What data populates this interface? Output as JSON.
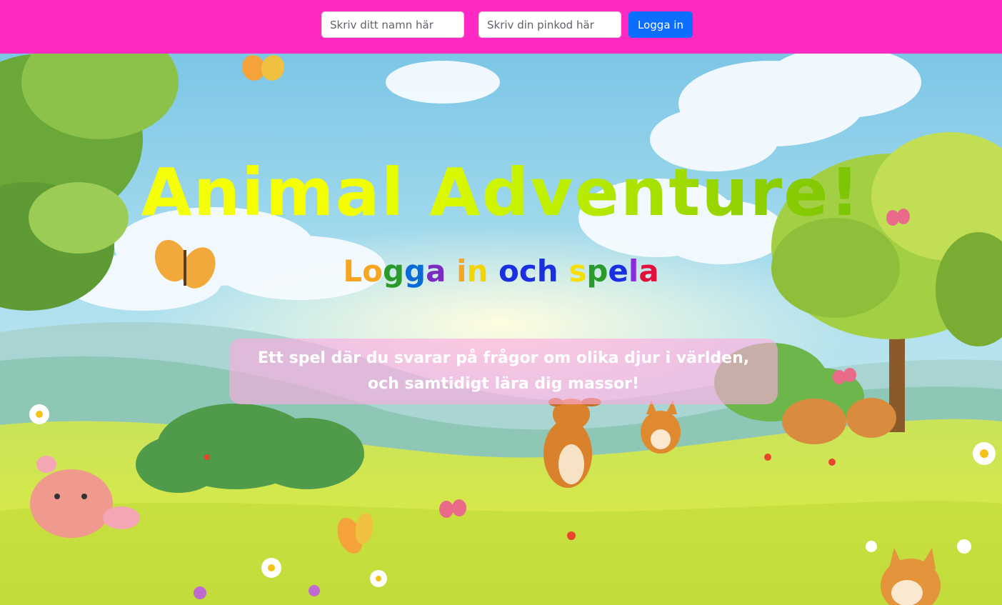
{
  "header": {
    "name_placeholder": "Skriv ditt namn här",
    "pin_placeholder": "Skriv din pinkod här",
    "login_label": "Logga in",
    "background_color": "#ff2ac4",
    "button_color": "#0d6efd"
  },
  "hero": {
    "title": "Animal Adventure!",
    "subtitle_letters": [
      {
        "ch": "L",
        "color": "#f5a623"
      },
      {
        "ch": "o",
        "color": "#f5a623"
      },
      {
        "ch": "g",
        "color": "#2a9a2a"
      },
      {
        "ch": "g",
        "color": "#0a6bd6"
      },
      {
        "ch": "a",
        "color": "#7b2cbf"
      },
      {
        "ch": " ",
        "color": "#ffffff"
      },
      {
        "ch": "i",
        "color": "#f5a623"
      },
      {
        "ch": "n",
        "color": "#f5d500"
      },
      {
        "ch": " ",
        "color": "#ffffff"
      },
      {
        "ch": "o",
        "color": "#1a2fe0"
      },
      {
        "ch": "c",
        "color": "#1a2fe0"
      },
      {
        "ch": "h",
        "color": "#1a2fe0"
      },
      {
        "ch": " ",
        "color": "#ffffff"
      },
      {
        "ch": "s",
        "color": "#f5e000"
      },
      {
        "ch": "p",
        "color": "#2a9a2a"
      },
      {
        "ch": "e",
        "color": "#1a2fe0"
      },
      {
        "ch": "l",
        "color": "#8a2be2"
      },
      {
        "ch": "a",
        "color": "#e0103a"
      }
    ],
    "description": "Ett spel där du svarar på frågor om olika djur i världen, och samtidigt lära dig massor!"
  },
  "background_scene": "meadow-with-animals-and-butterflies"
}
